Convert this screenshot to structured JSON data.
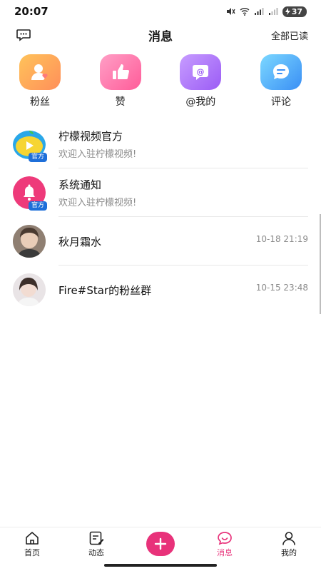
{
  "status_bar": {
    "time": "20:07",
    "battery": "37",
    "icons": [
      "mute-icon",
      "wifi-icon",
      "signal-icon",
      "signal-icon-2",
      "battery-icon"
    ]
  },
  "header": {
    "title": "消息",
    "left_icon": "message-bubble-icon",
    "right_action": "全部已读"
  },
  "quick_actions": [
    {
      "label": "粉丝",
      "icon": "fans-icon"
    },
    {
      "label": "赞",
      "icon": "thumbs-up-icon"
    },
    {
      "label": "@我的",
      "icon": "at-icon"
    },
    {
      "label": "评论",
      "icon": "comment-icon"
    }
  ],
  "messages": [
    {
      "name": "柠檬视频官方",
      "preview": "欢迎入驻柠檬视频!",
      "badge": "官方",
      "time": ""
    },
    {
      "name": "系统通知",
      "preview": "欢迎入驻柠檬视频!",
      "badge": "官方",
      "time": ""
    },
    {
      "name": "秋月霜水",
      "preview": "",
      "time": "10-18 21:19"
    },
    {
      "name": "Fire#Star的粉丝群",
      "preview": "",
      "time": "10-15 23:48"
    }
  ],
  "bottom_nav": [
    {
      "label": "首页",
      "icon": "home-icon"
    },
    {
      "label": "动态",
      "icon": "edit-note-icon"
    },
    {
      "label": "",
      "icon": "plus-icon"
    },
    {
      "label": "消息",
      "icon": "chat-icon",
      "active": true
    },
    {
      "label": "我的",
      "icon": "person-icon"
    }
  ],
  "colors": {
    "accent": "#e8327a",
    "badge_blue": "#1e6fd9",
    "muted_text": "#8c8c8c"
  }
}
